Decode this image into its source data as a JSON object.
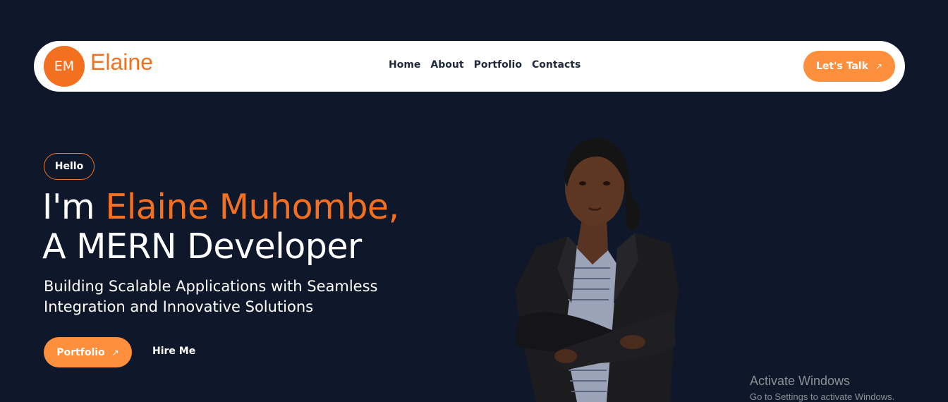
{
  "nav": {
    "logo_initials": "EM",
    "logo_name": "Elaine",
    "links": [
      "Home",
      "About",
      "Portfolio",
      "Contacts"
    ],
    "cta_label": "Let's Talk",
    "cta_icon": "arrow-up-right-icon"
  },
  "hero": {
    "greeting": "Hello",
    "headline_prefix": "I'm ",
    "headline_name": "Elaine Muhombe,",
    "headline_role": "A MERN Developer",
    "tagline": "Building Scalable Applications with Seamless Integration and Innovative Solutions",
    "primary_button": "Portfolio",
    "primary_icon": "arrow-up-right-icon",
    "secondary_link": "Hire Me"
  },
  "watermark": {
    "title": "Activate Windows",
    "subtitle": "Go to Settings to activate Windows."
  },
  "colors": {
    "background": "#0f172a",
    "accent": "#f37021",
    "button": "#fd8f3d"
  }
}
